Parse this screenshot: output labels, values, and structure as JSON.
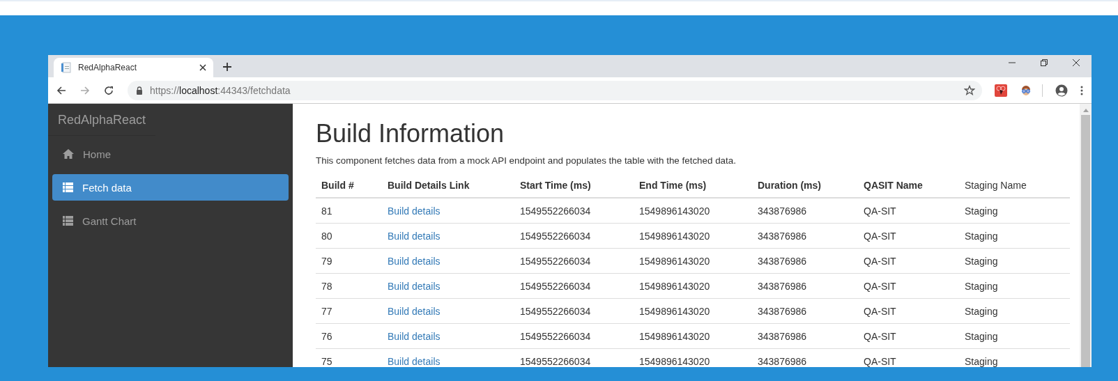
{
  "browser": {
    "tab": {
      "title": "RedAlphaReact",
      "selected": true
    },
    "url": {
      "scheme": "https://",
      "host": "localhost",
      "rest": ":44343/fetchdata"
    }
  },
  "sidebar": {
    "brand": "RedAlphaReact",
    "items": [
      {
        "label": "Home",
        "kind": "home",
        "selected": false
      },
      {
        "label": "Fetch data",
        "kind": "list",
        "selected": true
      },
      {
        "label": "Gantt Chart",
        "kind": "list",
        "selected": false
      }
    ]
  },
  "page": {
    "title": "Build Information",
    "description": "This component fetches data from a mock API endpoint and populates the table with the fetched data."
  },
  "table": {
    "columns": [
      {
        "label": "Build #",
        "bold": true
      },
      {
        "label": "Build Details Link",
        "bold": true
      },
      {
        "label": "Start Time (ms)",
        "bold": true
      },
      {
        "label": "End Time (ms)",
        "bold": true
      },
      {
        "label": "Duration (ms)",
        "bold": true
      },
      {
        "label": "QASIT Name",
        "bold": true
      },
      {
        "label": "Staging Name",
        "bold": false
      }
    ],
    "rows": [
      [
        "81",
        "Build details",
        "1549552266034",
        "1549896143020",
        "343876986",
        "QA-SIT",
        "Staging"
      ],
      [
        "80",
        "Build details",
        "1549552266034",
        "1549896143020",
        "343876986",
        "QA-SIT",
        "Staging"
      ],
      [
        "79",
        "Build details",
        "1549552266034",
        "1549896143020",
        "343876986",
        "QA-SIT",
        "Staging"
      ],
      [
        "78",
        "Build details",
        "1549552266034",
        "1549896143020",
        "343876986",
        "QA-SIT",
        "Staging"
      ],
      [
        "77",
        "Build details",
        "1549552266034",
        "1549896143020",
        "343876986",
        "QA-SIT",
        "Staging"
      ],
      [
        "76",
        "Build details",
        "1549552266034",
        "1549896143020",
        "343876986",
        "QA-SIT",
        "Staging"
      ],
      [
        "75",
        "Build details",
        "1549552266034",
        "1549896143020",
        "343876986",
        "QA-SIT",
        "Staging"
      ]
    ]
  }
}
